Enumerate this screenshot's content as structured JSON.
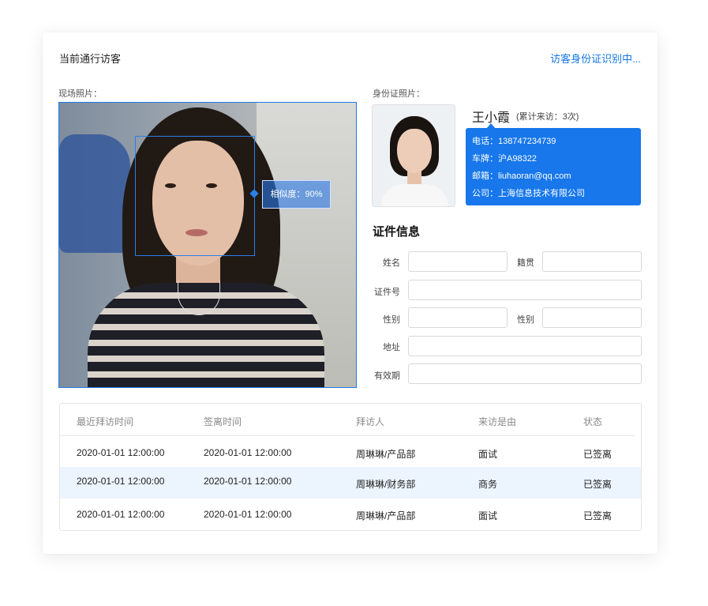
{
  "header": {
    "title": "当前通行访客",
    "status_link": "访客身份证识别中..."
  },
  "live_photo": {
    "label": "现场照片：",
    "similarity_tag": "相似度：90%"
  },
  "id_photo": {
    "label": "身份证照片："
  },
  "visitor": {
    "name": "王小霞",
    "visit_count": "(累计来访：3次)",
    "phone": "电话：13874723​4739",
    "plate": "车牌：沪A98322",
    "email": "邮箱：liuhaoran@qq.com",
    "company": "公司：上海信息技术有限公司"
  },
  "cert_info": {
    "title": "证件信息",
    "fields": {
      "name": {
        "label": "姓名",
        "value": ""
      },
      "origin": {
        "label": "籍贯",
        "value": ""
      },
      "id_number": {
        "label": "证件号",
        "value": ""
      },
      "gender": {
        "label": "性别",
        "value": ""
      },
      "gender2": {
        "label": "性别",
        "value": ""
      },
      "address": {
        "label": "地址",
        "value": ""
      },
      "validity": {
        "label": "有效期",
        "value": ""
      }
    }
  },
  "table": {
    "headers": [
      "最近拜访时间",
      "签离时间",
      "拜访人",
      "来访是由",
      "状态"
    ],
    "rows": [
      [
        "2020-01-01 12:00:00",
        "2020-01-01 12:00:00",
        "周琳琳/产品部",
        "面试",
        "已签离"
      ],
      [
        "2020-01-01 12:00:00",
        "2020-01-01 12:00:00",
        "周琳琳/财务部",
        "商务",
        "已签离"
      ],
      [
        "2020-01-01 12:00:00",
        "2020-01-01 12:00:00",
        "周琳琳/产品部",
        "面试",
        "已签离"
      ]
    ]
  },
  "colors": {
    "accent": "#1677e6",
    "info_box": "#1777eb",
    "row_highlight": "#ecf4fe"
  }
}
